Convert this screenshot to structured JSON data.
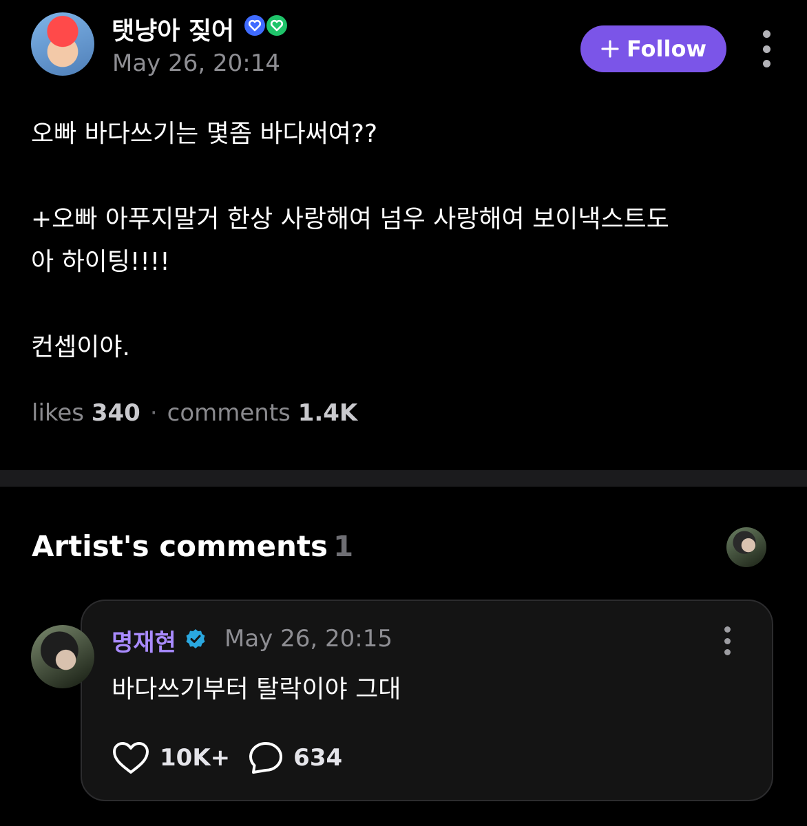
{
  "post": {
    "author": "탯냥아 짖어",
    "date": "May 26, 20:14",
    "follow_label": "Follow",
    "body": [
      "오빠 바다쓰기는 몇좀 바다써여??",
      "+오빠 아푸지말거 한상 사랑해여 넘우 사랑해여 보이낵스트도",
      "아 하이팅!!!!",
      "컨셉이야."
    ],
    "stats": {
      "likes_label": "likes",
      "likes_value": "340",
      "comments_label": "comments",
      "comments_value": "1.4K"
    }
  },
  "artist_comments": {
    "title": "Artist's comments",
    "count": "1",
    "comment": {
      "author": "명재현",
      "date": "May 26, 20:15",
      "text": "바다쓰기부터 탈락이야 그대",
      "likes": "10K+",
      "replies": "634"
    }
  },
  "colors": {
    "follow_button": "#7b55e8",
    "artist_name": "#a98bff",
    "verified": "#2aa8e0",
    "background": "#000000"
  },
  "icons": [
    "kebab-menu-icon",
    "plus-icon",
    "heart-icon",
    "comment-bubble-icon",
    "verified-icon"
  ]
}
